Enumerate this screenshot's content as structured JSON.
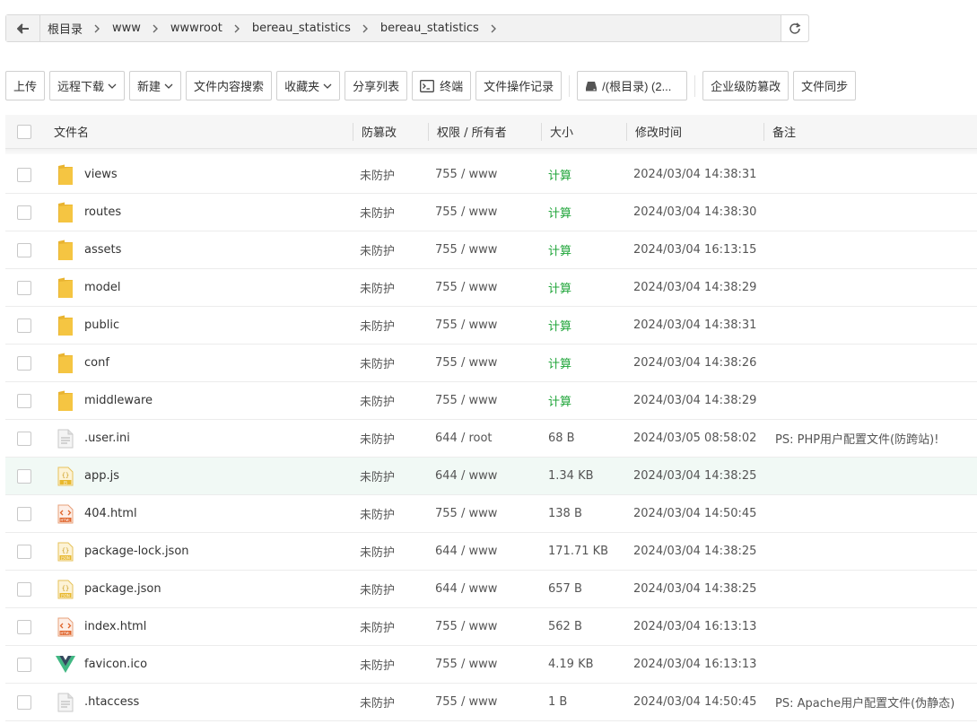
{
  "breadcrumb": [
    "根目录",
    "www",
    "wwwroot",
    "bereau_statistics",
    "bereau_statistics"
  ],
  "toolbar": {
    "upload": "上传",
    "remote_download": "远程下载",
    "new": "新建",
    "content_search": "文件内容搜索",
    "favorites": "收藏夹",
    "share_list": "分享列表",
    "terminal": "终端",
    "op_log": "文件操作记录",
    "disk": "/(根目录) (2...",
    "tamper_proof": "企业级防篡改",
    "file_sync": "文件同步"
  },
  "columns": {
    "name": "文件名",
    "protect": "防篡改",
    "perm": "权限 / 所有者",
    "size": "大小",
    "mtime": "修改时间",
    "note": "备注"
  },
  "files": [
    {
      "name": "views",
      "icon": "folder-icon",
      "protect": "未防护",
      "perm": "755 / www",
      "size": "计算",
      "mtime": "2024/03/04 14:38:31",
      "note": ""
    },
    {
      "name": "routes",
      "icon": "folder-icon",
      "protect": "未防护",
      "perm": "755 / www",
      "size": "计算",
      "mtime": "2024/03/04 14:38:30",
      "note": ""
    },
    {
      "name": "assets",
      "icon": "folder-icon",
      "protect": "未防护",
      "perm": "755 / www",
      "size": "计算",
      "mtime": "2024/03/04 16:13:15",
      "note": ""
    },
    {
      "name": "model",
      "icon": "folder-icon",
      "protect": "未防护",
      "perm": "755 / www",
      "size": "计算",
      "mtime": "2024/03/04 14:38:29",
      "note": ""
    },
    {
      "name": "public",
      "icon": "folder-icon",
      "protect": "未防护",
      "perm": "755 / www",
      "size": "计算",
      "mtime": "2024/03/04 14:38:31",
      "note": ""
    },
    {
      "name": "conf",
      "icon": "folder-icon",
      "protect": "未防护",
      "perm": "755 / www",
      "size": "计算",
      "mtime": "2024/03/04 14:38:26",
      "note": ""
    },
    {
      "name": "middleware",
      "icon": "folder-icon",
      "protect": "未防护",
      "perm": "755 / www",
      "size": "计算",
      "mtime": "2024/03/04 14:38:29",
      "note": ""
    },
    {
      "name": ".user.ini",
      "icon": "text-file-icon",
      "protect": "未防护",
      "perm": "644 / root",
      "size": "68 B",
      "mtime": "2024/03/05 08:58:02",
      "note": "PS: PHP用户配置文件(防跨站)!"
    },
    {
      "name": "app.js",
      "icon": "js-file-icon",
      "protect": "未防护",
      "perm": "644 / www",
      "size": "1.34 KB",
      "mtime": "2024/03/04 14:38:25",
      "note": ""
    },
    {
      "name": "404.html",
      "icon": "html-file-icon",
      "protect": "未防护",
      "perm": "755 / www",
      "size": "138 B",
      "mtime": "2024/03/04 14:50:45",
      "note": ""
    },
    {
      "name": "package-lock.json",
      "icon": "json-file-icon",
      "protect": "未防护",
      "perm": "644 / www",
      "size": "171.71 KB",
      "mtime": "2024/03/04 14:38:25",
      "note": ""
    },
    {
      "name": "package.json",
      "icon": "json-file-icon",
      "protect": "未防护",
      "perm": "644 / www",
      "size": "657 B",
      "mtime": "2024/03/04 14:38:25",
      "note": ""
    },
    {
      "name": "index.html",
      "icon": "html-file-icon",
      "protect": "未防护",
      "perm": "755 / www",
      "size": "562 B",
      "mtime": "2024/03/04 16:13:13",
      "note": ""
    },
    {
      "name": "favicon.ico",
      "icon": "vue-logo-icon",
      "protect": "未防护",
      "perm": "755 / www",
      "size": "4.19 KB",
      "mtime": "2024/03/04 16:13:13",
      "note": ""
    },
    {
      "name": ".htaccess",
      "icon": "text-file-icon",
      "protect": "未防护",
      "perm": "755 / www",
      "size": "1 B",
      "mtime": "2024/03/04 14:50:45",
      "note": "PS: Apache用户配置文件(伪静态)"
    }
  ],
  "highlighted_row": "app.js",
  "colors": {
    "accent_green": "#20a53a",
    "folder": "#f5c542",
    "highlight_row": "#f1f9f5"
  }
}
